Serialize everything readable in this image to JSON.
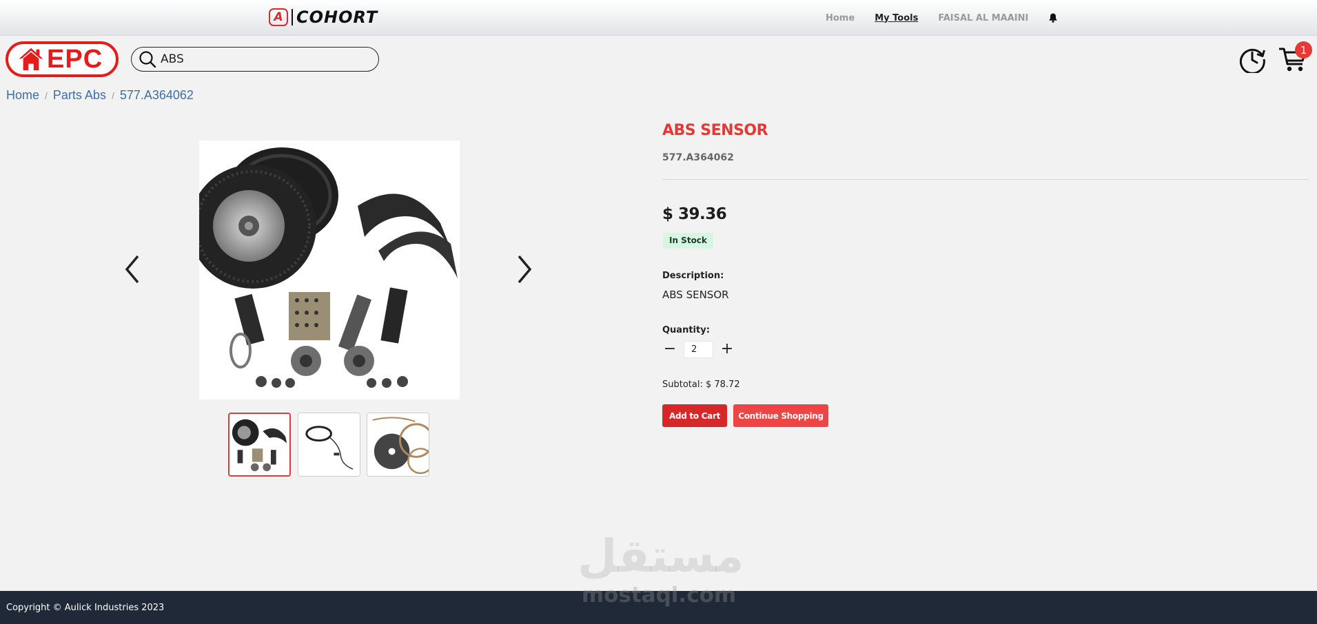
{
  "header": {
    "brand_mark": "A",
    "brand_name": "COHORT",
    "nav": {
      "home": "Home",
      "my_tools": "My Tools",
      "user": "FAISAL AL MAAINI"
    }
  },
  "toolbar": {
    "logo_text": "EPC",
    "search_value": "ABS",
    "cart_count": "1"
  },
  "breadcrumb": [
    "Home",
    "Parts Abs",
    "577.A364062"
  ],
  "product": {
    "title": "ABS SENSOR",
    "sku": "577.A364062",
    "price": "$ 39.36",
    "stock": "In Stock",
    "description_label": "Description:",
    "description": "ABS SENSOR",
    "quantity_label": "Quantity:",
    "quantity": "2",
    "minus": "−",
    "plus": "+",
    "subtotal": "Subtotal: $ 78.72",
    "add_to_cart": "Add to Cart",
    "continue_shopping": "Continue Shopping"
  },
  "gallery": {
    "images": [
      "trailer-kit-image",
      "cable-image",
      "brake-gasket-image"
    ],
    "active_index": 0
  },
  "watermark": {
    "arabic": "مستقل",
    "latin": "mostaql.com"
  },
  "footer": {
    "copyright": "Copyright © Aulick Industries 2023"
  },
  "colors": {
    "accent": "#e53935",
    "button_primary": "#d62828",
    "button_secondary": "#ef4444",
    "link": "#3a6ea5",
    "stock_bg": "#d6f5e3",
    "footer_bg": "#1f2937"
  }
}
